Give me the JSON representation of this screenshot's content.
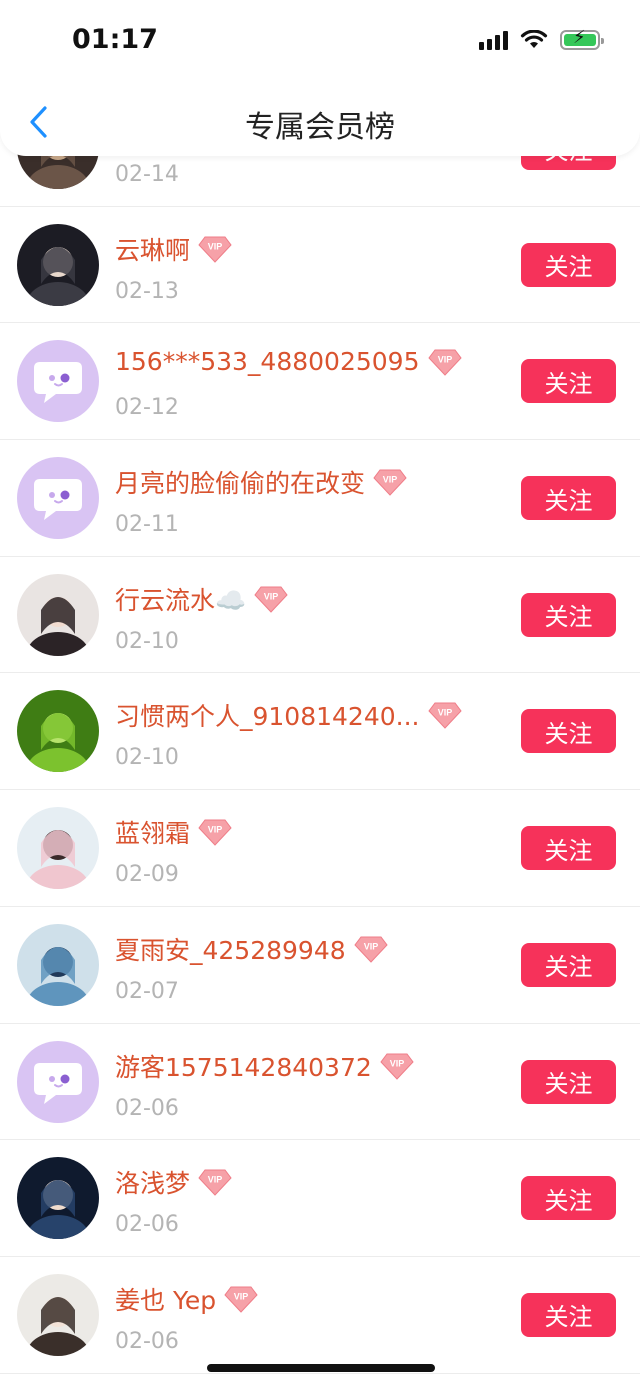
{
  "status_bar": {
    "time": "01:17"
  },
  "nav": {
    "title": "专属会员榜",
    "back_icon": "chevron-left-icon"
  },
  "colors": {
    "accent": "#f6325a",
    "name": "#d9532f",
    "date": "#b4b4b4",
    "default_avatar": "#d9c4f3"
  },
  "members": [
    {
      "name": "",
      "date": "02-14",
      "vip": false,
      "avatar": "photo-dark",
      "follow": "关注"
    },
    {
      "name": "云琳啊",
      "date": "02-13",
      "vip": true,
      "avatar": "photo-girl-dark",
      "follow": "关注"
    },
    {
      "name": "156***533_4880025095",
      "date": "02-12",
      "vip": true,
      "avatar": "default-chat",
      "follow": "关注"
    },
    {
      "name": "月亮的脸偷偷的在改变",
      "date": "02-11",
      "vip": true,
      "avatar": "default-chat",
      "follow": "关注"
    },
    {
      "name": "行云流水☁️",
      "date": "02-10",
      "vip": true,
      "avatar": "photo-anime-boy",
      "follow": "关注"
    },
    {
      "name": "习惯两个人_910814240...",
      "date": "02-10",
      "vip": true,
      "avatar": "photo-grass",
      "follow": "关注"
    },
    {
      "name": "蓝翎霜",
      "date": "02-09",
      "vip": true,
      "avatar": "photo-girl-pink",
      "follow": "关注"
    },
    {
      "name": "夏雨安_425289948",
      "date": "02-07",
      "vip": true,
      "avatar": "photo-blue-flowers",
      "follow": "关注"
    },
    {
      "name": "游客1575142840372",
      "date": "02-06",
      "vip": true,
      "avatar": "default-chat",
      "follow": "关注"
    },
    {
      "name": "洛浅梦",
      "date": "02-06",
      "vip": true,
      "avatar": "photo-girl-night",
      "follow": "关注"
    },
    {
      "name": "姜也 Yep",
      "date": "02-06",
      "vip": true,
      "avatar": "photo-girl-white",
      "follow": "关注"
    }
  ]
}
